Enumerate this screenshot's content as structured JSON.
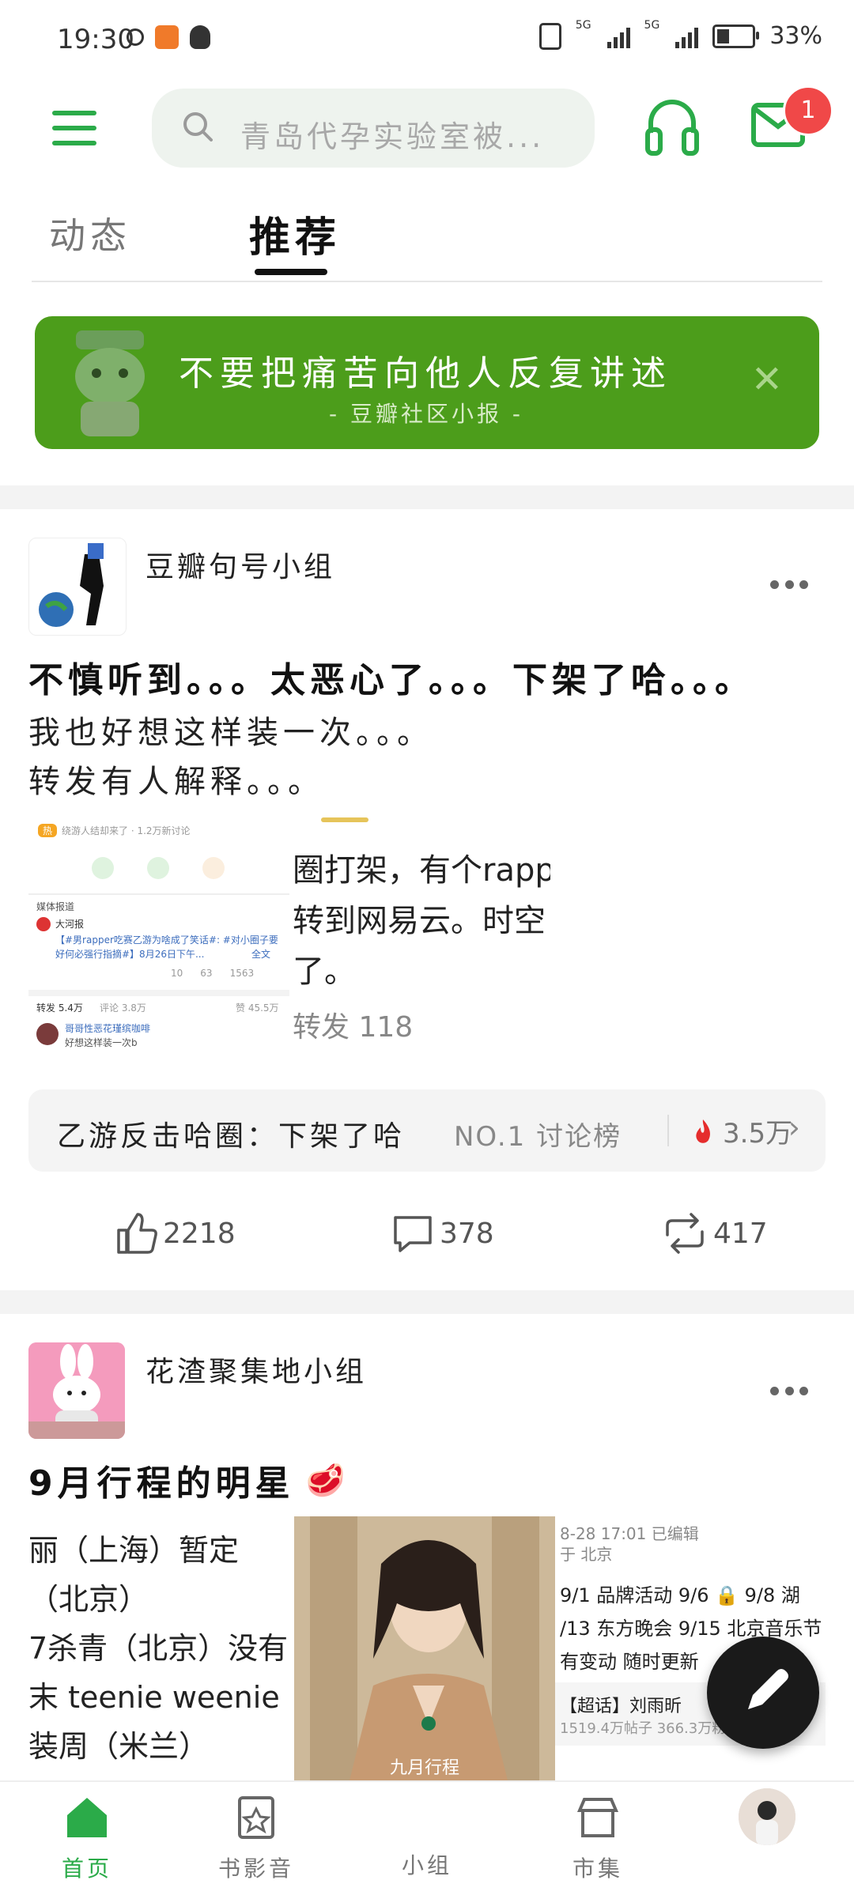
{
  "status_bar": {
    "time": "19:30",
    "network1": "5G",
    "network2": "5G",
    "battery": "33%",
    "battery_level": 0.33
  },
  "search": {
    "placeholder": "青岛代孕实验室被..."
  },
  "notifications": {
    "badge": "1"
  },
  "tabs": [
    {
      "label": "动态",
      "active": false
    },
    {
      "label": "推荐",
      "active": true
    }
  ],
  "banner": {
    "title": "不要把痛苦向他人反复讲述",
    "subtitle": "- 豆瓣社区小报 -",
    "close": "✕"
  },
  "post1": {
    "group": "豆瓣句号小组",
    "title": "不慎听到。。。太恶心了。。。下架了哈。。。",
    "lines": [
      "我也好想这样装一次。。。",
      "转发有人解释。。。"
    ],
    "embed": {
      "left": {
        "tag": "热",
        "hot_line": "绕游人结却来了 · 1.2万新讨论",
        "media_label": "媒体报道",
        "user": "大河报",
        "snippet": "【#男rapper吃赛乙游为啥成了笑话#: #对小圈子要好何必强行指摘#】8月26日下午...",
        "full_text": "全文",
        "stats": [
          "10",
          "63",
          "1563"
        ],
        "forward": "转发 5.4万",
        "comment": "评论 3.8万",
        "like": "赞 45.5万",
        "commenter": "哥哥性恶花瑾缤咖啡",
        "comment_text": "好想这样装一次b"
      },
      "right": {
        "line1": "圈打架，有个rapp",
        "line2": "转到网易云。时空",
        "line3": "了。",
        "forward": "转发 118"
      }
    },
    "topic": {
      "name": "乙游反击哈圈：下架了哈",
      "rank": "NO.1 讨论榜",
      "heat": "3.5万"
    },
    "actions": {
      "like": "2218",
      "comment": "378",
      "repost": "417"
    }
  },
  "post2": {
    "group": "花渣聚集地小组",
    "title": "9月行程的明星",
    "emoji": "🥩",
    "left_lines": [
      "丽（上海）暂定",
      "（北京）",
      "7杀青（北京）没有",
      "末 teenie weenie（",
      "装周（米兰）"
    ],
    "image_caption": "九月行程",
    "meta": "8-28 17:01  已编辑",
    "meta2": "于 北京",
    "right_lines": [
      "9/1 品牌活动 9/6 🔒 9/8 湖",
      "/13 东方晚会 9/15 北京音乐节",
      "有变动 随时更新"
    ],
    "chaohua_name": "【超话】刘雨昕",
    "chaohua_stats": "1519.4万帖子 366.3万粉"
  },
  "bottom_nav": [
    {
      "label": "首页",
      "icon": "home-icon",
      "active": true
    },
    {
      "label": "书影音",
      "icon": "bookmovie-icon",
      "active": false
    },
    {
      "label": "小组",
      "icon": "group-icon",
      "active": false
    },
    {
      "label": "市集",
      "icon": "market-icon",
      "active": false
    },
    {
      "label": "",
      "icon": "profile-avatar",
      "active": false
    }
  ],
  "colors": {
    "accent": "#2bab49",
    "banner": "#4c9d1b",
    "badge": "#f04848"
  }
}
